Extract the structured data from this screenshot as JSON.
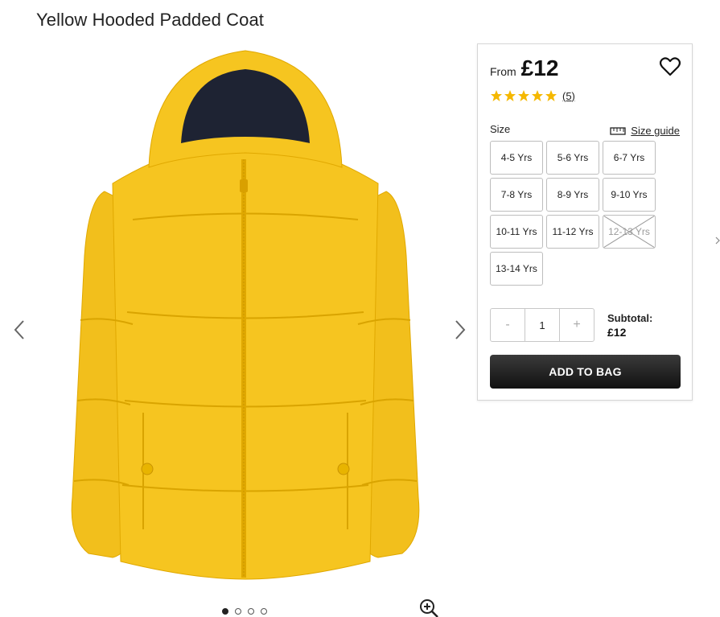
{
  "product": {
    "title": "Yellow Hooded Padded Coat"
  },
  "gallery": {
    "image_icon": "yellow-padded-coat-image",
    "prev_icon": "chevron-left-icon",
    "next_icon": "chevron-right-icon",
    "zoom_icon": "zoom-in-icon",
    "slide_count": 4,
    "active_slide": 1
  },
  "panel": {
    "price_prefix": "From",
    "price": "£12",
    "rating": {
      "stars": 5,
      "max": 5,
      "review_count": "(5)"
    },
    "size_label": "Size",
    "size_guide_label": "Size guide",
    "sizes": [
      {
        "label": "4-5 Yrs",
        "available": true
      },
      {
        "label": "5-6 Yrs",
        "available": true
      },
      {
        "label": "6-7 Yrs",
        "available": true
      },
      {
        "label": "7-8 Yrs",
        "available": true
      },
      {
        "label": "8-9 Yrs",
        "available": true
      },
      {
        "label": "9-10 Yrs",
        "available": true
      },
      {
        "label": "10-11 Yrs",
        "available": true
      },
      {
        "label": "11-12 Yrs",
        "available": true
      },
      {
        "label": "12-13 Yrs",
        "available": false
      },
      {
        "label": "13-14 Yrs",
        "available": true
      }
    ],
    "quantity": {
      "decrement": "-",
      "value": "1",
      "increment": "+"
    },
    "subtotal_label": "Subtotal:",
    "subtotal_value": "£12",
    "add_to_bag": "ADD TO BAG"
  },
  "colors": {
    "accent_star": "#f5b800",
    "button_dark": "#1a1a1a",
    "coat_yellow": "#f4c41f"
  }
}
